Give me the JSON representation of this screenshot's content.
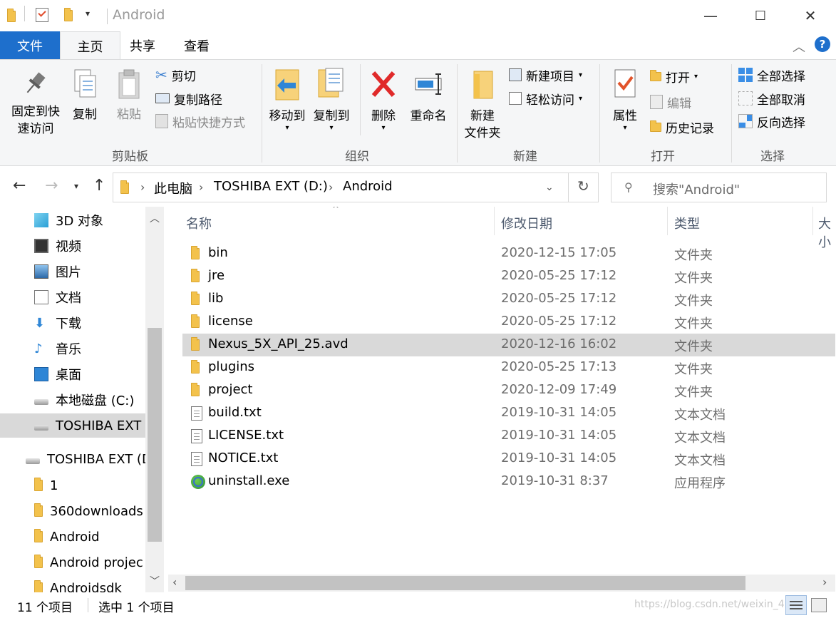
{
  "window": {
    "title": "Android",
    "minimize": "—",
    "maximize": "☐",
    "close": "✕"
  },
  "tabs": [
    {
      "label": "文件"
    },
    {
      "label": "主页"
    },
    {
      "label": "共享"
    },
    {
      "label": "查看"
    }
  ],
  "ribbon": {
    "clipboard": {
      "label": "剪贴板",
      "pin": "固定到快\n速访问",
      "pin1": "固定到快",
      "pin2": "速访问",
      "copy": "复制",
      "paste": "粘贴",
      "cut": "剪切",
      "copy_path": "复制路径",
      "paste_shortcut": "粘贴快捷方式"
    },
    "organize": {
      "label": "组织",
      "move_to": "移动到",
      "copy_to": "复制到",
      "delete": "删除",
      "rename": "重命名"
    },
    "new": {
      "label": "新建",
      "new_folder1": "新建",
      "new_folder2": "文件夹",
      "new_item": "新建项目",
      "easy_access": "轻松访问"
    },
    "open": {
      "label": "打开",
      "properties": "属性",
      "open": "打开",
      "edit": "编辑",
      "history": "历史记录"
    },
    "select": {
      "label": "选择",
      "select_all": "全部选择",
      "select_none": "全部取消",
      "invert": "反向选择"
    }
  },
  "address": {
    "crumbs": [
      "此电脑",
      "TOSHIBA EXT (D:)",
      "Android"
    ],
    "search_placeholder": "搜索\"Android\""
  },
  "nav": {
    "items": [
      {
        "label": "3D 对象",
        "icon": "3d-objects-icon"
      },
      {
        "label": "视频",
        "icon": "video-icon"
      },
      {
        "label": "图片",
        "icon": "pictures-icon"
      },
      {
        "label": "文档",
        "icon": "documents-icon"
      },
      {
        "label": "下载",
        "icon": "downloads-icon"
      },
      {
        "label": "音乐",
        "icon": "music-icon"
      },
      {
        "label": "桌面",
        "icon": "desktop-icon"
      },
      {
        "label": "本地磁盘 (C:)",
        "icon": "drive-icon"
      },
      {
        "label": "TOSHIBA EXT (",
        "icon": "drive-icon"
      },
      {
        "label": "TOSHIBA EXT (D",
        "icon": "drive-icon"
      },
      {
        "label": "1",
        "icon": "folder-icon"
      },
      {
        "label": "360downloads",
        "icon": "folder-icon"
      },
      {
        "label": "Android",
        "icon": "folder-icon"
      },
      {
        "label": "Android projec",
        "icon": "folder-icon"
      },
      {
        "label": "Androidsdk",
        "icon": "folder-icon"
      }
    ]
  },
  "columns": {
    "name": "名称",
    "date": "修改日期",
    "type": "类型",
    "size": "大小"
  },
  "files": [
    {
      "name": "bin",
      "date": "2020-12-15 17:05",
      "type": "文件夹",
      "icon": "folder-icon"
    },
    {
      "name": "jre",
      "date": "2020-05-25 17:12",
      "type": "文件夹",
      "icon": "folder-icon"
    },
    {
      "name": "lib",
      "date": "2020-05-25 17:12",
      "type": "文件夹",
      "icon": "folder-icon"
    },
    {
      "name": "license",
      "date": "2020-05-25 17:12",
      "type": "文件夹",
      "icon": "folder-icon"
    },
    {
      "name": "Nexus_5X_API_25.avd",
      "date": "2020-12-16 16:02",
      "type": "文件夹",
      "icon": "folder-icon",
      "selected": true
    },
    {
      "name": "plugins",
      "date": "2020-05-25 17:13",
      "type": "文件夹",
      "icon": "folder-icon"
    },
    {
      "name": "project",
      "date": "2020-12-09 17:49",
      "type": "文件夹",
      "icon": "folder-icon"
    },
    {
      "name": "build.txt",
      "date": "2019-10-31 14:05",
      "type": "文本文档",
      "icon": "text-file-icon"
    },
    {
      "name": "LICENSE.txt",
      "date": "2019-10-31 14:05",
      "type": "文本文档",
      "icon": "text-file-icon"
    },
    {
      "name": "NOTICE.txt",
      "date": "2019-10-31 14:05",
      "type": "文本文档",
      "icon": "text-file-icon"
    },
    {
      "name": "uninstall.exe",
      "date": "2019-10-31 8:37",
      "type": "应用程序",
      "icon": "exe-icon"
    }
  ],
  "status": {
    "count": "11 个项目",
    "selection": "选中 1 个项目"
  },
  "watermark": "https://blog.csdn.net/weixin_4",
  "colors": {
    "accent": "#1e6fcc",
    "selection": "#d9d9d9",
    "folder": "#f3c24c"
  }
}
